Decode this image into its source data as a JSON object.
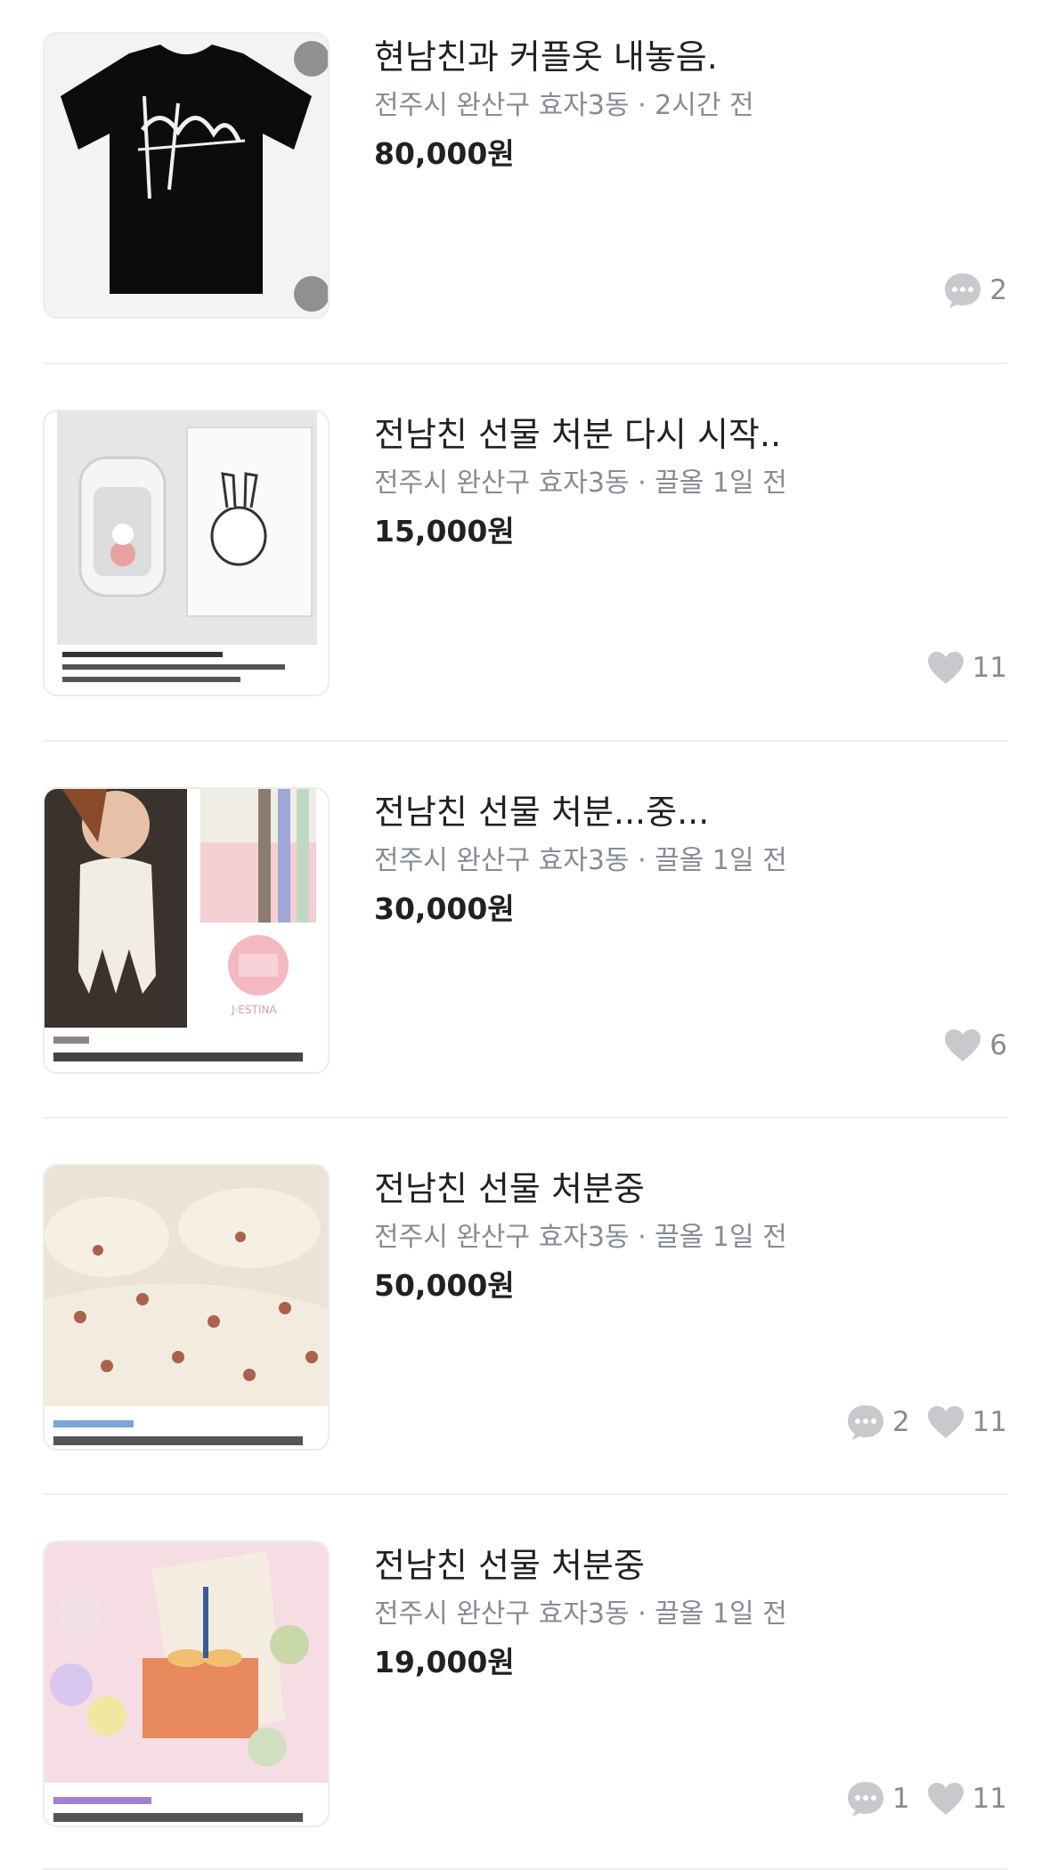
{
  "items": [
    {
      "title": "현남친과 커플옷 내놓음.",
      "location": "전주시 완산구 효자3동",
      "time": "2시간 전",
      "price": "80,000원",
      "thumb_icon": "tshirt-image",
      "chats": "2",
      "likes": null
    },
    {
      "title": "전남친 선물 처분 다시 시작..",
      "location": "전주시 완산구 효자3동",
      "time": "끌올 1일 전",
      "price": "15,000원",
      "thumb_icon": "humidifier-image",
      "chats": null,
      "likes": "11"
    },
    {
      "title": "전남친 선물 처분...중...",
      "location": "전주시 완산구 효자3동",
      "time": "끌올 1일 전",
      "price": "30,000원",
      "thumb_icon": "scarf-image",
      "chats": null,
      "likes": "6"
    },
    {
      "title": "전남친 선물 처분중",
      "location": "전주시 완산구 효자3동",
      "time": "끌올 1일 전",
      "price": "50,000원",
      "thumb_icon": "bedding-image",
      "chats": "2",
      "likes": "11"
    },
    {
      "title": "전남친 선물 처분중",
      "location": "전주시 완산구 효자3동",
      "time": "끌올 1일 전",
      "price": "19,000원",
      "thumb_icon": "gift-box-image",
      "chats": "1",
      "likes": "11"
    }
  ],
  "separator": " · ",
  "colors": {
    "text": "#212124",
    "subtext": "#868b94",
    "icon": "#c8c9cc",
    "divider": "#eeeeef"
  }
}
